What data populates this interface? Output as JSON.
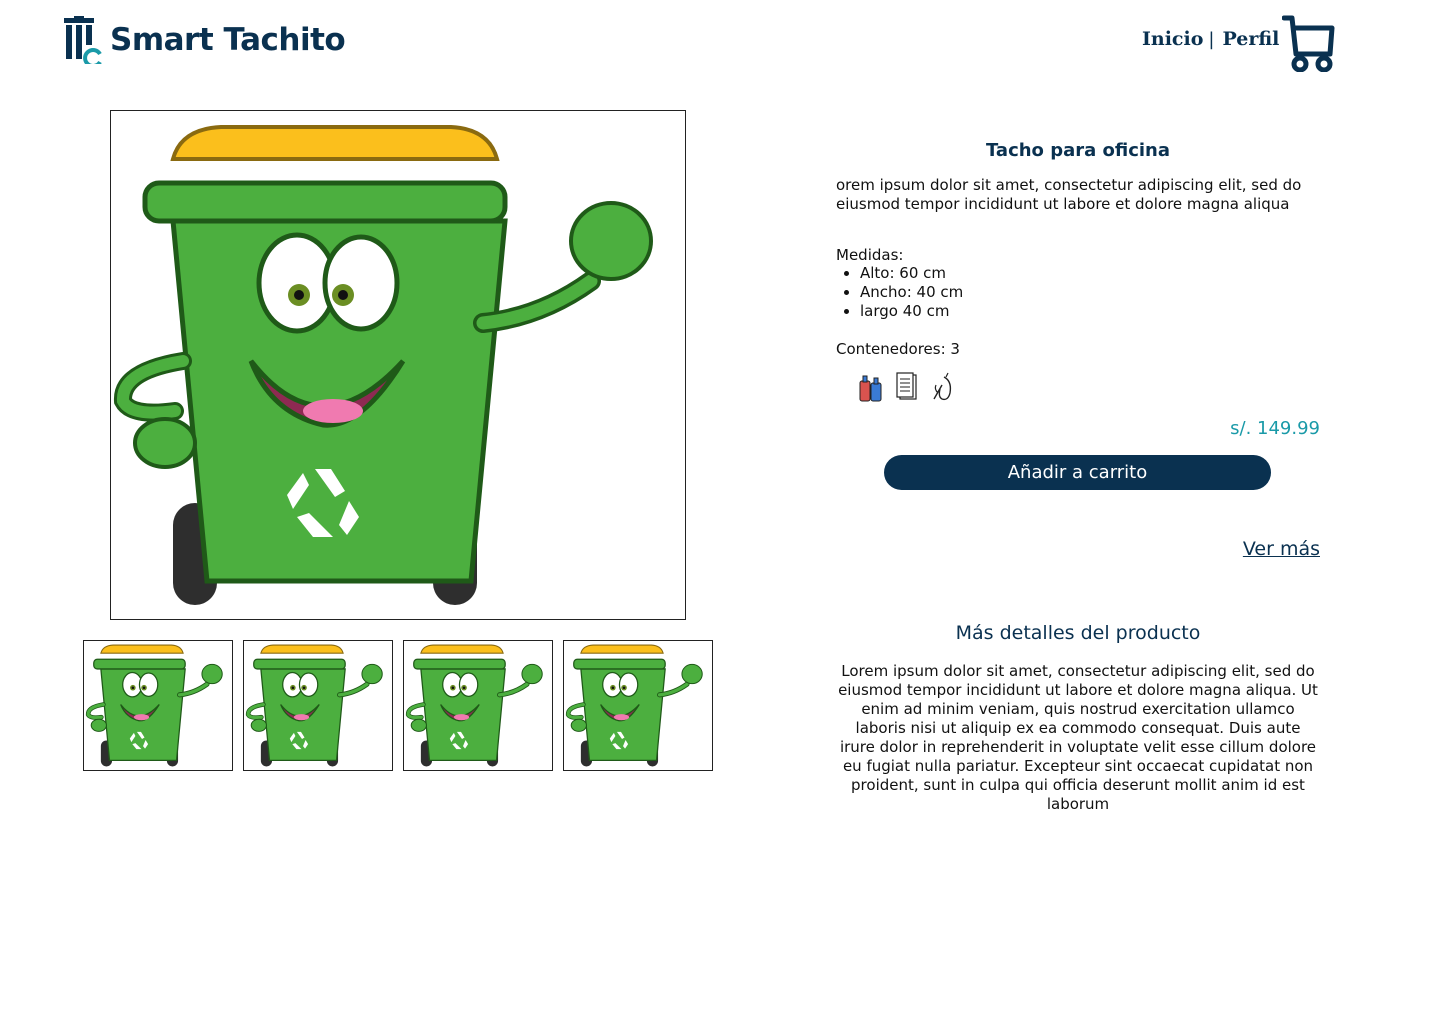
{
  "header": {
    "brand": "Smart Tachito",
    "nav": [
      {
        "label": "Inicio"
      },
      {
        "label": "Perfil"
      }
    ],
    "separator": "|"
  },
  "product": {
    "title": "Tacho para oficina",
    "short_description": "orem ipsum dolor sit amet, consectetur adipiscing elit, sed do eiusmod tempor incididunt ut labore et dolore magna aliqua",
    "medidas_label": "Medidas:",
    "medidas": [
      "Alto: 60 cm",
      "Ancho: 40 cm",
      "largo 40 cm"
    ],
    "contenedores": "Contenedores: 3",
    "bin_icons": [
      "bottles-icon",
      "paper-icon",
      "organic-icon"
    ],
    "price": "s/. 149.99",
    "add_to_cart": "Añadir a carrito",
    "ver_mas": "Ver más",
    "details_title": "Más detalles del producto",
    "details": "Lorem ipsum dolor sit amet, consectetur adipiscing elit, sed do eiusmod tempor incididunt ut labore et dolore magna aliqua. Ut enim ad minim veniam, quis nostrud exercitation ullamco laboris nisi ut aliquip ex ea commodo consequat. Duis aute irure dolor in reprehenderit in voluptate velit esse cillum dolore eu fugiat nulla pariatur. Excepteur sint occaecat cupidatat non proident, sunt in culpa qui officia deserunt mollit anim id est laborum"
  },
  "colors": {
    "brand": "#0a3150",
    "accent": "#1a9aa8",
    "bin_green": "#4caf3f",
    "lid_yellow": "#fbbf1c"
  }
}
